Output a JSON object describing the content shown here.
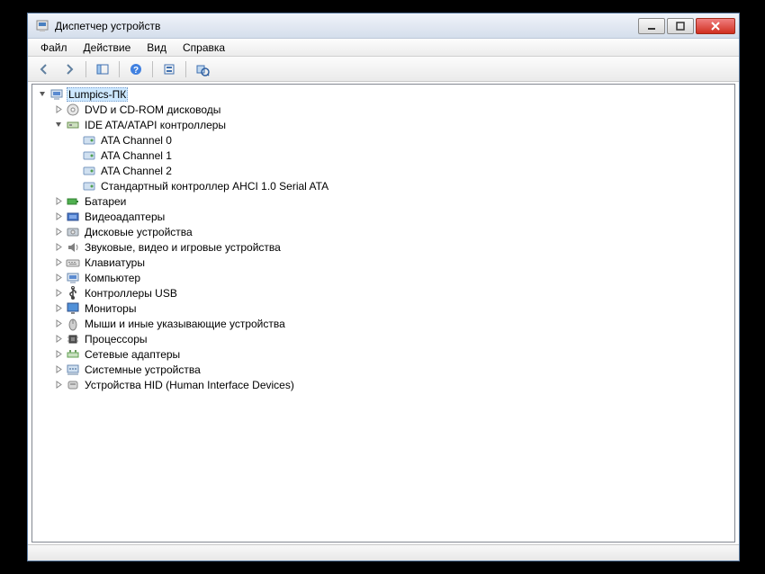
{
  "window": {
    "title": "Диспетчер устройств"
  },
  "menu": {
    "file": "Файл",
    "action": "Действие",
    "view": "Вид",
    "help": "Справка"
  },
  "tree": {
    "root": "Lumpics-ПК",
    "dvd": "DVD и CD-ROM дисководы",
    "ide": "IDE ATA/ATAPI контроллеры",
    "ata0": "ATA Channel 0",
    "ata1": "ATA Channel 1",
    "ata2": "ATA Channel 2",
    "ahci": "Стандартный контроллер AHCI 1.0 Serial ATA",
    "batteries": "Батареи",
    "video": "Видеоадаптеры",
    "disk": "Дисковые устройства",
    "audio": "Звуковые, видео и игровые устройства",
    "keyboard": "Клавиатуры",
    "computer": "Компьютер",
    "usb": "Контроллеры USB",
    "monitor": "Мониторы",
    "mouse": "Мыши и иные указывающие устройства",
    "cpu": "Процессоры",
    "network": "Сетевые адаптеры",
    "system": "Системные устройства",
    "hid": "Устройства HID (Human Interface Devices)"
  }
}
